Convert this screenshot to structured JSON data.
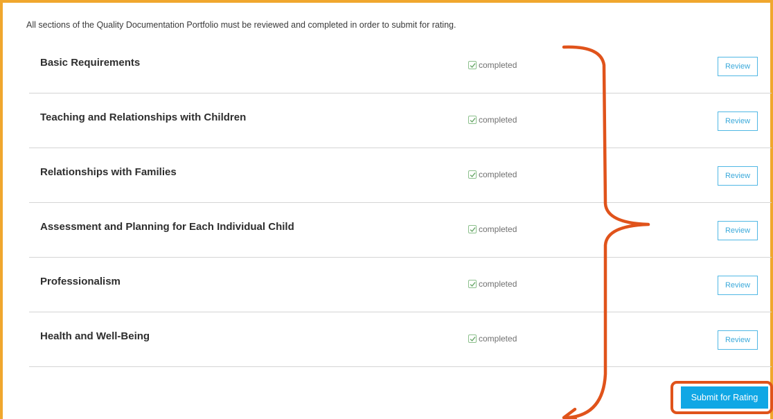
{
  "intro_text": "All sections of the Quality Documentation Portfolio must be reviewed and completed in order to submit for rating.",
  "sections": [
    {
      "title": "Basic Requirements",
      "status": "completed",
      "action": "Review"
    },
    {
      "title": "Teaching and Relationships with Children",
      "status": "completed",
      "action": "Review"
    },
    {
      "title": "Relationships with Families",
      "status": "completed",
      "action": "Review"
    },
    {
      "title": "Assessment and Planning for Each Individual Child",
      "status": "completed",
      "action": "Review"
    },
    {
      "title": "Professionalism",
      "status": "completed",
      "action": "Review"
    },
    {
      "title": "Health and Well-Being",
      "status": "completed",
      "action": "Review"
    }
  ],
  "submit_label": "Submit for Rating",
  "colors": {
    "panel_border": "#f0a72e",
    "annotation": "#e0531b",
    "button_blue": "#10a7e5",
    "review_border": "#4fb7e4",
    "check_green": "#8bbf8b"
  },
  "icons": {
    "status": "checkbox-check-icon",
    "annotation": "curly-brace-arrow-icon"
  }
}
